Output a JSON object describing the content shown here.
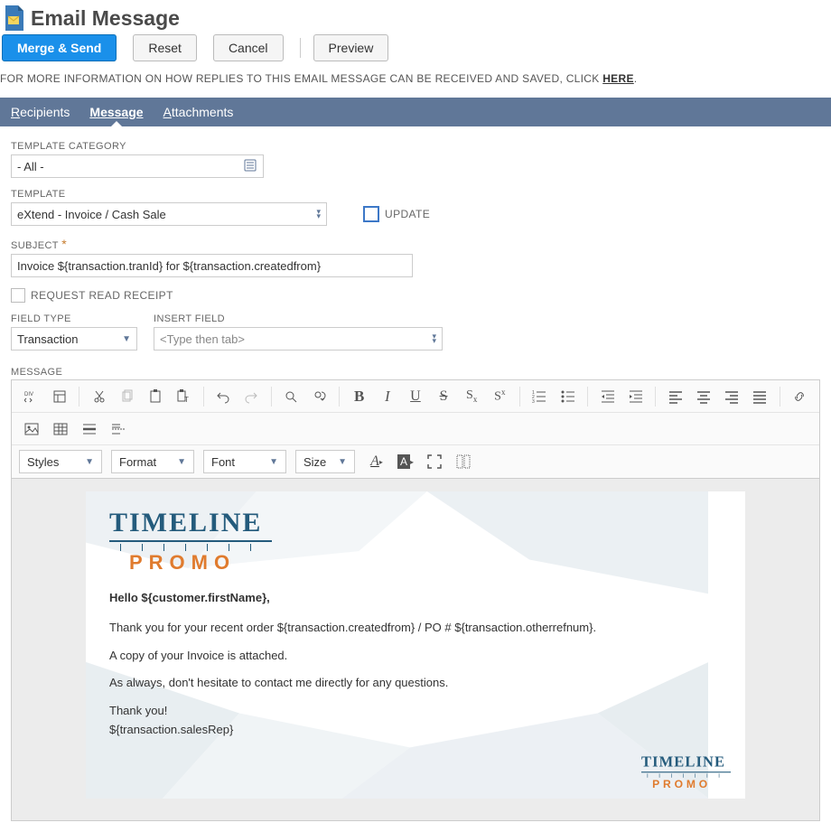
{
  "page": {
    "title": "Email Message"
  },
  "buttons": {
    "merge_send": "Merge & Send",
    "reset": "Reset",
    "cancel": "Cancel",
    "preview": "Preview"
  },
  "info": {
    "prefix": "FOR MORE INFORMATION ON HOW REPLIES TO THIS EMAIL MESSAGE CAN BE RECEIVED AND SAVED, CLICK ",
    "link": "HERE",
    "suffix": "."
  },
  "tabs": {
    "recipients": "ecipients",
    "recipients_u": "R",
    "message": "essage",
    "message_u": "M",
    "attachments": "ttachments",
    "attachments_u": "A"
  },
  "fields": {
    "template_category": {
      "label": "TEMPLATE CATEGORY",
      "value": "- All -"
    },
    "template": {
      "label": "TEMPLATE",
      "value": "eXtend - Invoice / Cash Sale"
    },
    "update": {
      "label": "UPDATE"
    },
    "subject": {
      "label": "SUBJECT",
      "value": "Invoice ${transaction.tranId} for ${transaction.createdfrom}"
    },
    "read_receipt": {
      "label": "REQUEST READ RECEIPT"
    },
    "field_type": {
      "label": "FIELD TYPE",
      "value": "Transaction"
    },
    "insert_field": {
      "label": "INSERT FIELD",
      "placeholder": "<Type then tab>"
    },
    "message": {
      "label": "MESSAGE"
    }
  },
  "toolbar": {
    "styles": "Styles",
    "format": "Format",
    "font": "Font",
    "size": "Size"
  },
  "email": {
    "greeting": "Hello ${customer.firstName},",
    "line1": "Thank you for your recent order ${transaction.createdfrom} / PO # ${transaction.otherrefnum}.",
    "line2": "A copy of your Invoice is attached.",
    "line3": "As always, don't hesitate to contact me directly for any questions.",
    "thank": "Thank you!",
    "rep": "${transaction.salesRep}",
    "logo_top": "TIMELINE",
    "logo_bottom": "PROMO"
  }
}
